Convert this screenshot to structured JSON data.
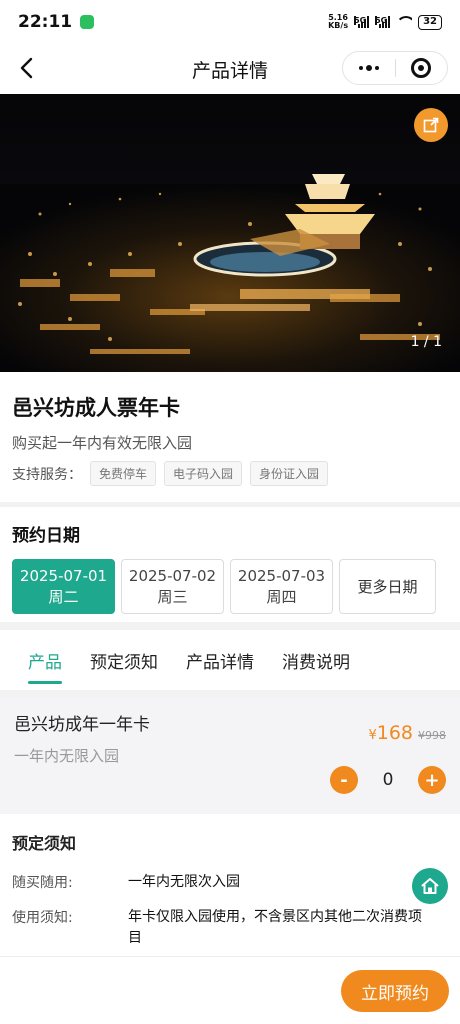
{
  "status_bar": {
    "time": "22:11",
    "net_speed_value": "5.16",
    "net_speed_unit": "KB/s",
    "signal_1": "5G",
    "signal_2": "5G",
    "battery": "32"
  },
  "navbar": {
    "title": "产品详情"
  },
  "hero": {
    "counter": "1 / 1"
  },
  "product": {
    "name": "邑兴坊成人票年卡",
    "description": "购买起一年内有效无限入园",
    "services_label": "支持服务：",
    "services": [
      "免费停车",
      "电子码入园",
      "身份证入园"
    ]
  },
  "booking": {
    "heading": "预约日期",
    "dates": [
      {
        "date": "2025-07-01",
        "weekday": "周二",
        "selected": true
      },
      {
        "date": "2025-07-02",
        "weekday": "周三",
        "selected": false
      },
      {
        "date": "2025-07-03",
        "weekday": "周四",
        "selected": false
      }
    ],
    "more_label": "更多日期"
  },
  "tabs": [
    {
      "label": "产品",
      "active": true
    },
    {
      "label": "预定须知",
      "active": false
    },
    {
      "label": "产品详情",
      "active": false
    },
    {
      "label": "消费说明",
      "active": false
    }
  ],
  "item": {
    "name": "邑兴坊成年一年卡",
    "subtitle": "一年内无限入园",
    "currency": "¥",
    "price": "168",
    "original_price": "¥998",
    "quantity": "0",
    "minus": "-",
    "plus": "+"
  },
  "notice": {
    "heading": "预定须知",
    "rows": [
      {
        "key": "随买随用:",
        "value": "一年内无限次入园"
      },
      {
        "key": "使用须知:",
        "value": "年卡仅限入园使用，不含景区内其他二次消费项目"
      }
    ]
  },
  "cta": {
    "label": "立即预约"
  },
  "colors": {
    "accent_green": "#1ea88d",
    "accent_orange": "#f0891e"
  }
}
